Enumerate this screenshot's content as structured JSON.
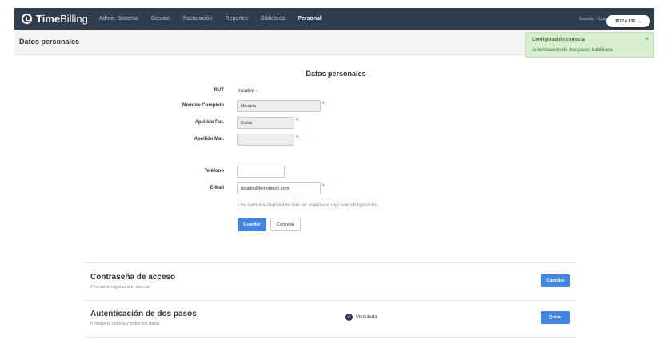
{
  "app": {
    "logo_bold": "Time",
    "logo_light": "Billing"
  },
  "nav": {
    "items": [
      "Admin. Sistema",
      "Gestión",
      "Facturación",
      "Reportes",
      "Biblioteca",
      "Personal"
    ],
    "active": "Personal",
    "support": "Soporte - Con"
  },
  "resolution": {
    "label": "1512 x 833",
    "icon": "chevron-down-icon"
  },
  "page": {
    "title": "Datos personales"
  },
  "toast": {
    "title": "Configuración correcta",
    "message": "Autenticación de dos pasos habilitada",
    "close": "×",
    "color": "#d8eed0"
  },
  "form": {
    "title": "Datos personales",
    "rut_label": "RUT",
    "rut_value": "mcatini -",
    "nombre_label": "Nombre Completo",
    "nombre_value": "Micaela",
    "apellido_pat_label": "Apellido Pat.",
    "apellido_pat_value": "Catini",
    "apellido_mat_label": "Apellido Mat.",
    "apellido_mat_value": "",
    "telefono_label": "Teléfono",
    "telefono_value": "",
    "email_label": "E-Mail",
    "email_value": "mcatini@lemontech.com",
    "required_mark": "*",
    "hint": "Los campos marcados con un asterisco rojo son obligatorios.",
    "save_label": "Guardar",
    "cancel_label": "Cancelar"
  },
  "password_section": {
    "title": "Contraseña de acceso",
    "subtitle": "Permite el ingreso a tu cuenta",
    "button": "Cambiar"
  },
  "twofa_section": {
    "title": "Autenticación de dos pasos",
    "subtitle": "Protege tu cuenta y todos tus datos",
    "status": "Vinculada",
    "status_icon": "check-circle-icon",
    "button": "Quitar"
  },
  "colors": {
    "topbar": "#2f3e4d",
    "primary": "#4285e0",
    "required": "#e03030"
  }
}
